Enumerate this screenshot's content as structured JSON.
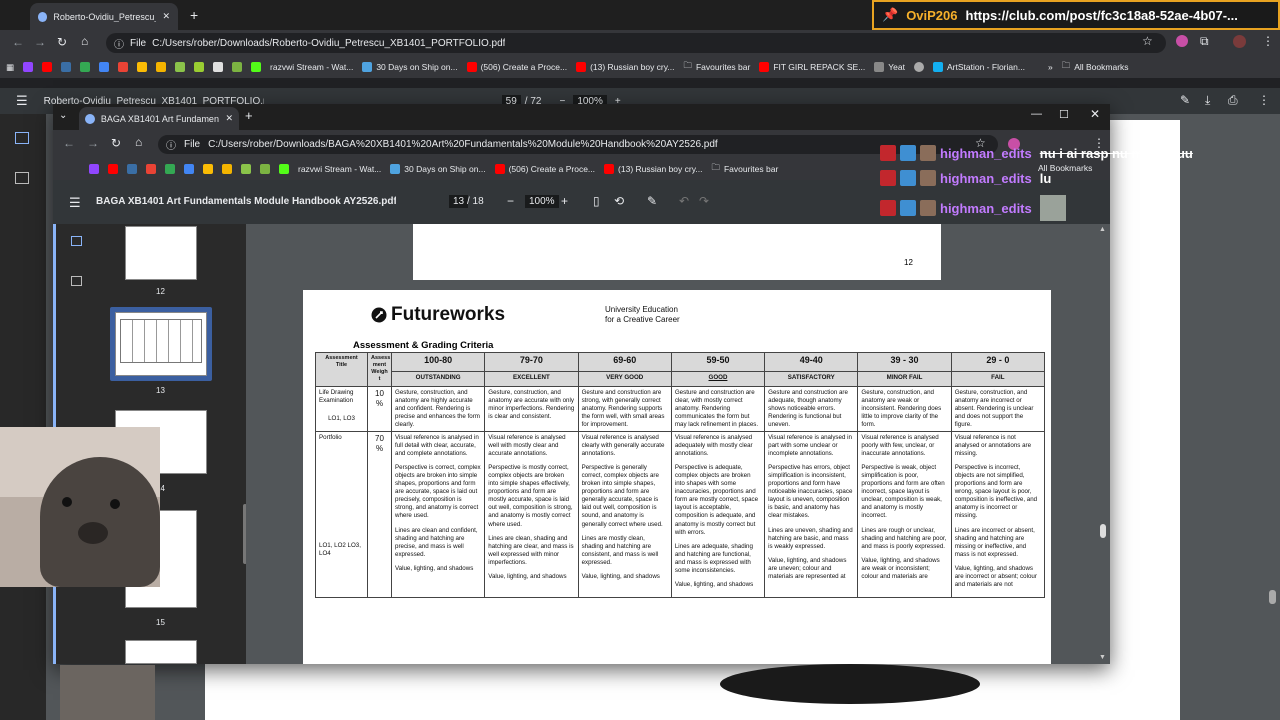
{
  "back_browser": {
    "tab_title": "Roberto-Ovidiu_Petrescu_XB1401",
    "url": "C:/Users/rober/Downloads/Roberto-Ovidiu_Petrescu_XB1401_PORTFOLIO.pdf",
    "file_chip": "File",
    "pdf_title": "Roberto-Ovidiu_Petrescu_XB1401_PORTFOLIO.pdf",
    "page_current": "59",
    "page_total": "/ 72",
    "zoom": "100%",
    "bookmarks": [
      "razvwi Stream - Wat...",
      "30 Days on Ship on...",
      "(506) Create a Proce...",
      "(13) Russian boy cry...",
      "Favourites bar",
      "FIT GIRL REPACK SE...",
      "Yeat",
      "ArtStation - Florian..."
    ],
    "all_bookmarks": "All Bookmarks"
  },
  "stream_overlay": {
    "title_user": "OviP206",
    "title_url": "https://club.com/post/fc3c18a8-52ae-4b07-...",
    "chat": [
      {
        "user": "highman_edits",
        "message": "nu i ai rasp nu manutzuu"
      },
      {
        "user": "highman_edits",
        "message": "lu"
      },
      {
        "user": "highman_edits",
        "message": ""
      }
    ]
  },
  "front_browser": {
    "tab_title": "BAGA XB1401 Art Fundamental",
    "url": "C:/Users/rober/Downloads/BAGA%20XB1401%20Art%20Fundamentals%20Module%20Handbook%20AY2526.pdf",
    "file_chip": "File",
    "bookmarks": [
      "razvwi Stream - Wat...",
      "30 Days on Ship on...",
      "(506) Create a Proce...",
      "(13) Russian boy cry...",
      "Favourites bar"
    ],
    "all_bookmarks": "All Bookmarks",
    "pdf_title": "BAGA XB1401 Art Fundamentals Module Handbook AY2526.pdf",
    "page_current": "13",
    "page_total": "/ 18",
    "zoom": "100%",
    "thumb_labels": [
      "12",
      "13",
      "14",
      "15"
    ],
    "prev_page_number": "12"
  },
  "document": {
    "brand": "Futureworks",
    "brand_sub1": "University Education",
    "brand_sub2": "for a Creative Career",
    "heading": "Assessment & Grading Criteria",
    "col_title": "Assessment Title",
    "col_weight": "Assess ment Weigh t",
    "bands": [
      "100-80",
      "79-70",
      "69-60",
      "59-50",
      "49-40",
      "39 - 30",
      "29 - 0"
    ],
    "grades": [
      "OUTSTANDING",
      "EXCELLENT",
      "VERY GOOD",
      "GOOD",
      "SATISFACTORY",
      "MINOR FAIL",
      "FAIL"
    ],
    "rows": [
      {
        "title": "Life Drawing Examination",
        "lo": "LO1, LO3",
        "weight": "10 %",
        "cells": [
          "Gesture, construction, and anatomy are highly accurate and confident. Rendering is precise and enhances the form clearly.",
          "Gesture, construction, and anatomy are accurate with only minor imperfections. Rendering is clear and consistent.",
          "Gesture and construction are strong, with generally correct anatomy. Rendering supports the form well, with small areas for improvement.",
          "Gesture and construction are clear, with mostly correct anatomy. Rendering communicates the form but may lack refinement in places.",
          "Gesture and construction are adequate, though anatomy shows noticeable errors. Rendering is functional but uneven.",
          "Gesture, construction, and anatomy are weak or inconsistent. Rendering does little to improve clarity of the form.",
          "Gesture, construction, and anatomy are incorrect or absent. Rendering is unclear and does not support the figure."
        ]
      },
      {
        "title": "Portfolio",
        "lo": "LO1, LO2 LO3, LO4",
        "weight": "70 %",
        "cells": [
          [
            "Visual reference is analysed in full detail with clear, accurate, and complete annotations.",
            "Perspective is correct, complex objects are broken into simple shapes, proportions and form are accurate, space is laid out precisely, composition is strong, and anatomy is correct where used.",
            "Lines are clean and confident, shading and hatching are precise, and mass is well expressed.",
            "Value, lighting, and shadows"
          ],
          [
            "Visual reference is analysed well with mostly clear and accurate annotations.",
            "Perspective is mostly correct, complex objects are broken into simple shapes effectively, proportions and form are mostly accurate, space is laid out well, composition is strong, and anatomy is mostly correct where used.",
            "Lines are clean, shading and hatching are clear, and mass is well expressed with minor imperfections.",
            "Value, lighting, and shadows"
          ],
          [
            "Visual reference is analysed clearly with generally accurate annotations.",
            "Perspective is generally correct, complex objects are broken into simple shapes, proportions and form are generally accurate, space is laid out well, composition is sound, and anatomy is generally correct where used.",
            "Lines are mostly clean, shading and hatching are consistent, and mass is well expressed.",
            "Value, lighting, and shadows"
          ],
          [
            "Visual reference is analysed adequately with mostly clear annotations.",
            "Perspective is adequate, complex objects are broken into shapes with some inaccuracies, proportions and form are mostly correct, space layout is acceptable, composition is adequate, and anatomy is mostly correct but with errors.",
            "Lines are adequate, shading and hatching are functional, and mass is expressed with some inconsistencies.",
            "Value, lighting, and shadows"
          ],
          [
            "Visual reference is analysed in part with some unclear or incomplete annotations.",
            "Perspective has errors, object simplification is inconsistent, proportions and form have noticeable inaccuracies, space layout is uneven, composition is basic, and anatomy has clear mistakes.",
            "Lines are uneven, shading and hatching are basic, and mass is weakly expressed.",
            "Value, lighting, and shadows are uneven; colour and materials are represented at"
          ],
          [
            "Visual reference is analysed poorly with few, unclear, or inaccurate annotations.",
            "Perspective is weak, object simplification is poor, proportions and form are often incorrect, space layout is unclear, composition is weak, and anatomy is mostly incorrect.",
            "Lines are rough or unclear, shading and hatching are poor, and mass is poorly expressed.",
            "Value, lighting, and shadows are weak or inconsistent; colour and materials are"
          ],
          [
            "Visual reference is not analysed or annotations are missing.",
            "Perspective is incorrect, objects are not simplified, proportions and form are wrong, space layout is poor, composition is ineffective, and anatomy is incorrect or missing.",
            "Lines are incorrect or absent, shading and hatching are missing or ineffective, and mass is not expressed.",
            "Value, lighting, and shadows are incorrect or absent; colour and materials are not"
          ]
        ]
      }
    ]
  }
}
